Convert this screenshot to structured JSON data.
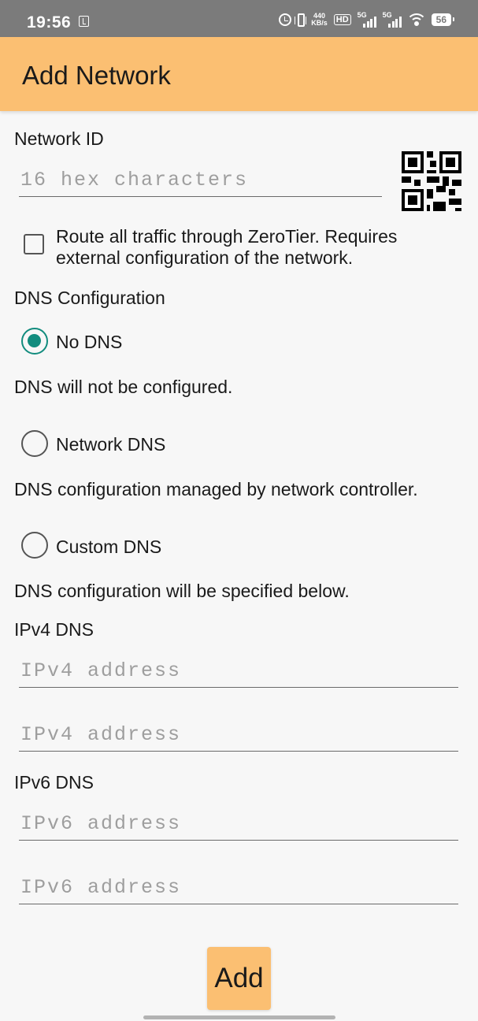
{
  "status_bar": {
    "time": "19:56",
    "net_speed_value": "440",
    "net_speed_unit": "KB/s",
    "hd_label": "HD",
    "signal1_label": "5G",
    "signal2_label": "5G",
    "battery": "56",
    "icons": [
      "usb-icon",
      "alarm-icon",
      "vibrate-icon",
      "hd-icon",
      "signal-icon",
      "wifi-icon",
      "battery-icon"
    ]
  },
  "app_bar": {
    "title": "Add Network",
    "color": "#fbbf72"
  },
  "network_id": {
    "label": "Network ID",
    "placeholder": "16 hex characters",
    "qr_icon": "qr-code-icon"
  },
  "route_all": {
    "checked": false,
    "text": "Route all traffic through ZeroTier. Requires external configuration of the network."
  },
  "dns": {
    "section_label": "DNS Configuration",
    "selected_color": "#128c7e",
    "options": [
      {
        "label": "No DNS",
        "selected": true,
        "description": "DNS will not be configured."
      },
      {
        "label": "Network DNS",
        "selected": false,
        "description": "DNS configuration managed by network controller."
      },
      {
        "label": "Custom DNS",
        "selected": false,
        "description": "DNS configuration will be specified below."
      }
    ]
  },
  "ipv4": {
    "label": "IPv4 DNS",
    "placeholders": [
      "IPv4 address",
      "IPv4 address"
    ]
  },
  "ipv6": {
    "label": "IPv6 DNS",
    "placeholders": [
      "IPv6 address",
      "IPv6 address"
    ]
  },
  "add_button": {
    "label": "Add"
  }
}
